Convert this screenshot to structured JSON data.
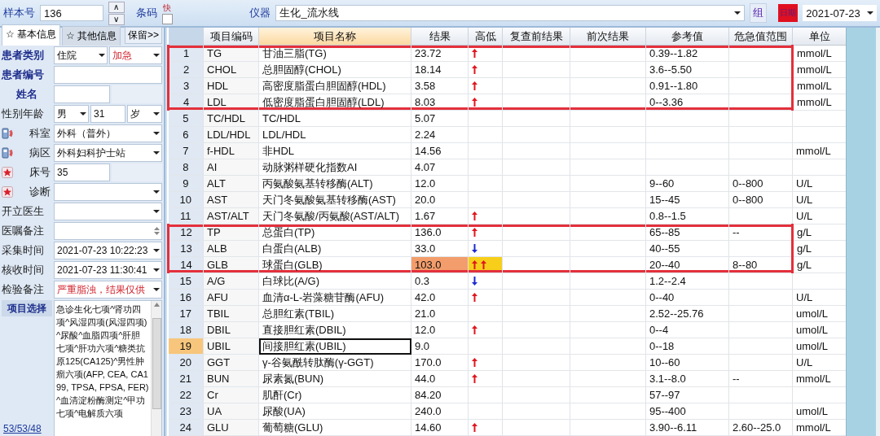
{
  "toolbar": {
    "sample_label": "样本号",
    "sample_value": "136",
    "up_button": "∧",
    "down_button": "∨",
    "barcode_label": "条码",
    "urgent_label": "快",
    "urgent_checked": false,
    "instrument_label": "仪器",
    "instrument_value": "生化_流水线",
    "group_button": "组",
    "date_label": "日期",
    "date_value": "2021-07-23"
  },
  "side_tabs": [
    {
      "label": "☆ 基本信息",
      "selected": true
    },
    {
      "label": "☆ 其他信息",
      "selected": false
    }
  ],
  "keep_button": "保留>>",
  "form": [
    {
      "label": "患者类别",
      "kind": "bold",
      "controls": [
        {
          "kind": "select",
          "value": "住院",
          "alert": false
        },
        {
          "kind": "select",
          "value": "加急",
          "alert": true
        }
      ]
    },
    {
      "label": "患者编号",
      "kind": "bold",
      "controls": [
        {
          "kind": "text"
        }
      ]
    },
    {
      "label": "姓名",
      "kind": "center",
      "controls": [
        {
          "kind": "text"
        },
        {
          "kind": "empty"
        }
      ]
    },
    {
      "label": "性别年龄",
      "kind": "plain",
      "controls": [
        {
          "kind": "select",
          "value": "男",
          "alert": false
        },
        {
          "kind": "text",
          "value": "31"
        },
        {
          "kind": "select",
          "value": "岁",
          "alert": false
        }
      ]
    },
    {
      "label": "科室",
      "kind": "device",
      "controls": [
        {
          "kind": "select",
          "value": "外科（普外）",
          "alert": false
        }
      ]
    },
    {
      "label": "病区",
      "kind": "device",
      "controls": [
        {
          "kind": "select",
          "value": "外科妇科护士站",
          "alert": false
        }
      ]
    },
    {
      "label": "床号",
      "kind": "star",
      "controls": [
        {
          "kind": "text",
          "value": "35"
        },
        {
          "kind": "empty"
        }
      ]
    },
    {
      "label": "诊断",
      "kind": "star",
      "controls": [
        {
          "kind": "select"
        }
      ]
    },
    {
      "label": "开立医生",
      "kind": "plain",
      "controls": [
        {
          "kind": "select"
        }
      ]
    },
    {
      "label": "医嘱备注",
      "kind": "plain",
      "controls": [
        {
          "kind": "spin"
        }
      ]
    },
    {
      "label": "采集时间",
      "kind": "plain",
      "controls": [
        {
          "kind": "select",
          "value": "2021-07-23 10:22:23",
          "alert": false
        }
      ]
    },
    {
      "label": "核收时间",
      "kind": "plain",
      "controls": [
        {
          "kind": "select",
          "value": "2021-07-23 11:30:41",
          "alert": false
        }
      ]
    },
    {
      "label": "检验备注",
      "kind": "plain",
      "controls": [
        {
          "kind": "select",
          "value": "严重脂浊，结果仅供",
          "alert": true
        }
      ]
    }
  ],
  "item_select": {
    "label": "项目选择",
    "value": "急诊生化七项^肾功四项^风湿四项(风湿四项)^尿酸^血脂四项^肝胆七项^肝功六项^糖类抗原125(CA125)^男性肿瘤六项(AFP, CEA, CA199, TPSA, FPSA, FER)^血清淀粉酶测定^甲功七项^电解质六项"
  },
  "counts_link": "53/53/48",
  "table": {
    "columns": [
      {
        "selected": false
      },
      {
        "label": "项目编码",
        "selected": false
      },
      {
        "label": "项目名称",
        "selected": true
      },
      {
        "label": "结果",
        "selected": false
      },
      {
        "label": "高低",
        "selected": false
      },
      {
        "label": "复查前结果",
        "selected": false
      },
      {
        "label": "前次结果",
        "selected": false
      },
      {
        "label": "参考值",
        "selected": false
      },
      {
        "label": "危急值范围",
        "selected": false
      },
      {
        "label": "单位",
        "selected": false
      }
    ],
    "rows": [
      {
        "no": "1",
        "code": "TG",
        "name": "甘油三脂(TG)",
        "result": "23.72",
        "kind": "high",
        "reference": "0.39--1.82",
        "critical": "",
        "unit": "mmol/L",
        "selected": false,
        "outlined": true
      },
      {
        "no": "2",
        "code": "CHOL",
        "name": "总胆固醇(CHOL)",
        "result": "18.14",
        "kind": "high",
        "reference": "3.6--5.50",
        "critical": "",
        "unit": "mmol/L",
        "selected": false,
        "outlined": true
      },
      {
        "no": "3",
        "code": "HDL",
        "name": "高密度脂蛋白胆固醇(HDL)",
        "result": "3.58",
        "kind": "high",
        "reference": "0.91--1.80",
        "critical": "",
        "unit": "mmol/L",
        "selected": false,
        "outlined": true
      },
      {
        "no": "4",
        "code": "LDL",
        "name": "低密度脂蛋白胆固醇(LDL)",
        "result": "8.03",
        "kind": "high",
        "reference": "0--3.36",
        "critical": "",
        "unit": "mmol/L",
        "selected": false,
        "outlined": true
      },
      {
        "no": "5",
        "code": "TC/HDL",
        "name": "TC/HDL",
        "result": "5.07",
        "kind": "normal",
        "reference": "",
        "critical": "",
        "unit": "",
        "selected": false,
        "outlined": false
      },
      {
        "no": "6",
        "code": "LDL/HDL",
        "name": "LDL/HDL",
        "result": "2.24",
        "kind": "normal",
        "reference": "",
        "critical": "",
        "unit": "",
        "selected": false,
        "outlined": false
      },
      {
        "no": "7",
        "code": "f-HDL",
        "name": "非HDL",
        "result": "14.56",
        "kind": "normal",
        "reference": "",
        "critical": "",
        "unit": "mmol/L",
        "selected": false,
        "outlined": false
      },
      {
        "no": "8",
        "code": "AI",
        "name": "动脉粥样硬化指数AI",
        "result": "4.07",
        "kind": "normal",
        "reference": "",
        "critical": "",
        "unit": "",
        "selected": false,
        "outlined": false
      },
      {
        "no": "9",
        "code": "ALT",
        "name": "丙氨酸氨基转移酶(ALT)",
        "result": "12.0",
        "kind": "normal",
        "reference": "9--60",
        "critical": "0--800",
        "unit": "U/L",
        "selected": false,
        "outlined": false
      },
      {
        "no": "10",
        "code": "AST",
        "name": "天门冬氨酸氨基转移酶(AST)",
        "result": "20.0",
        "kind": "normal",
        "reference": "15--45",
        "critical": "0--800",
        "unit": "U/L",
        "selected": false,
        "outlined": false
      },
      {
        "no": "11",
        "code": "AST/ALT",
        "name": "天门冬氨酸/丙氨酸(AST/ALT)",
        "result": "1.67",
        "kind": "high",
        "reference": "0.8--1.5",
        "critical": "",
        "unit": "U/L",
        "selected": false,
        "outlined": false
      },
      {
        "no": "12",
        "code": "TP",
        "name": "总蛋白(TP)",
        "result": "136.0",
        "kind": "high",
        "reference": "65--85",
        "critical": "--",
        "unit": "g/L",
        "selected": false,
        "outlined": true
      },
      {
        "no": "13",
        "code": "ALB",
        "name": "白蛋白(ALB)",
        "result": "33.0",
        "kind": "low",
        "reference": "40--55",
        "critical": "",
        "unit": "g/L",
        "selected": false,
        "outlined": true
      },
      {
        "no": "14",
        "code": "GLB",
        "name": "球蛋白(GLB)",
        "result": "103.0",
        "kind": "very_high",
        "reference": "20--40",
        "critical": "8--80",
        "unit": "g/L",
        "selected": false,
        "outlined": true
      },
      {
        "no": "15",
        "code": "A/G",
        "name": "白球比(A/G)",
        "result": "0.3",
        "kind": "low",
        "reference": "1.2--2.4",
        "critical": "",
        "unit": "",
        "selected": false,
        "outlined": false
      },
      {
        "no": "16",
        "code": "AFU",
        "name": "血清α-L-岩藻糖苷酶(AFU)",
        "result": "42.0",
        "kind": "high",
        "reference": "0--40",
        "critical": "",
        "unit": "U/L",
        "selected": false,
        "outlined": false
      },
      {
        "no": "17",
        "code": "TBIL",
        "name": "总胆红素(TBIL)",
        "result": "21.0",
        "kind": "normal",
        "reference": "2.52--25.76",
        "critical": "",
        "unit": "umol/L",
        "selected": false,
        "outlined": false
      },
      {
        "no": "18",
        "code": "DBIL",
        "name": "直接胆红素(DBIL)",
        "result": "12.0",
        "kind": "high",
        "reference": "0--4",
        "critical": "",
        "unit": "umol/L",
        "selected": false,
        "outlined": false
      },
      {
        "no": "19",
        "code": "UBIL",
        "name": "间接胆红素(UBIL)",
        "result": "9.0",
        "kind": "normal",
        "reference": "0--18",
        "critical": "",
        "unit": "umol/L",
        "selected": true,
        "outlined": false
      },
      {
        "no": "20",
        "code": "GGT",
        "name": "γ-谷氨酰转肽酶(γ-GGT)",
        "result": "170.0",
        "kind": "high",
        "reference": "10--60",
        "critical": "",
        "unit": "U/L",
        "selected": false,
        "outlined": false
      },
      {
        "no": "21",
        "code": "BUN",
        "name": "尿素氮(BUN)",
        "result": "44.0",
        "kind": "high",
        "reference": "3.1--8.0",
        "critical": "--",
        "unit": "mmol/L",
        "selected": false,
        "outlined": false
      },
      {
        "no": "22",
        "code": "Cr",
        "name": "肌酐(Cr)",
        "result": "84.20",
        "kind": "normal",
        "reference": "57--97",
        "critical": "",
        "unit": "",
        "selected": false,
        "outlined": false
      },
      {
        "no": "23",
        "code": "UA",
        "name": "尿酸(UA)",
        "result": "240.0",
        "kind": "normal",
        "reference": "95--400",
        "critical": "",
        "unit": "umol/L",
        "selected": false,
        "outlined": false
      },
      {
        "no": "24",
        "code": "GLU",
        "name": "葡萄糖(GLU)",
        "result": "14.60",
        "kind": "high",
        "reference": "3.90--6.11",
        "critical": "2.60--25.0",
        "unit": "mmol/L",
        "selected": false,
        "outlined": false
      }
    ]
  }
}
